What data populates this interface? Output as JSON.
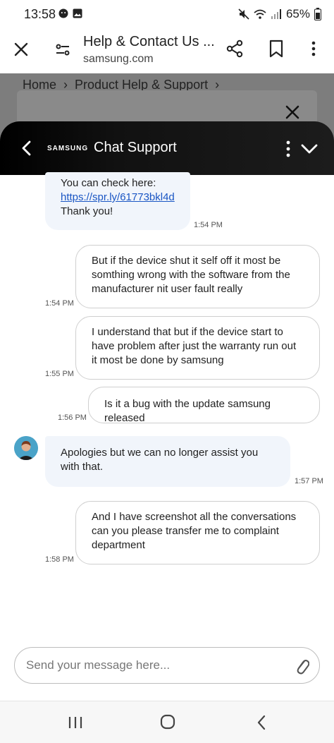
{
  "status_bar": {
    "time": "13:58",
    "battery": "65%"
  },
  "browser": {
    "title": "Help & Contact Us ...",
    "url": "samsung.com"
  },
  "page_behind": {
    "breadcrumb": [
      "Home",
      "Product Help & Support"
    ]
  },
  "chat_header": {
    "brand": "SAMSUNG",
    "title": "Chat Support"
  },
  "messages": [
    {
      "sender": "agent",
      "lines": [
        "You can check here:"
      ],
      "link": "https://spr.ly/61773bkl4d",
      "lines_after": [
        "Thank you!"
      ],
      "time": "1:54 PM"
    },
    {
      "sender": "user",
      "text": "But if the device shut it self off it most be somthing wrong with the software from the manufacturer nit user fault really",
      "time": "1:54 PM"
    },
    {
      "sender": "user",
      "text": "I understand that but if the device start to have problem after just the warranty run out it most be done by samsung",
      "time": "1:55 PM"
    },
    {
      "sender": "user",
      "text": "Is it a bug with the update samsung released",
      "time": "1:56 PM"
    },
    {
      "sender": "agent",
      "text": "Apologies but we can no longer assist you with that.",
      "time": "1:57 PM"
    },
    {
      "sender": "user",
      "text": "And I have screenshot all the conversations can you please transfer me to complaint department",
      "time": "1:58 PM"
    }
  ],
  "input": {
    "placeholder": "Send your message here..."
  },
  "icons": {
    "close": "close-icon",
    "tune": "tune-icon",
    "share": "share-icon",
    "bookmark": "bookmark-icon",
    "more": "more-vert-icon",
    "back": "chevron-left-icon",
    "collapse": "chevron-down-icon",
    "attach": "paperclip-icon"
  },
  "colors": {
    "header_bg": "#000000",
    "agent_bubble": "#f1f5fb",
    "link": "#1a56c4"
  }
}
